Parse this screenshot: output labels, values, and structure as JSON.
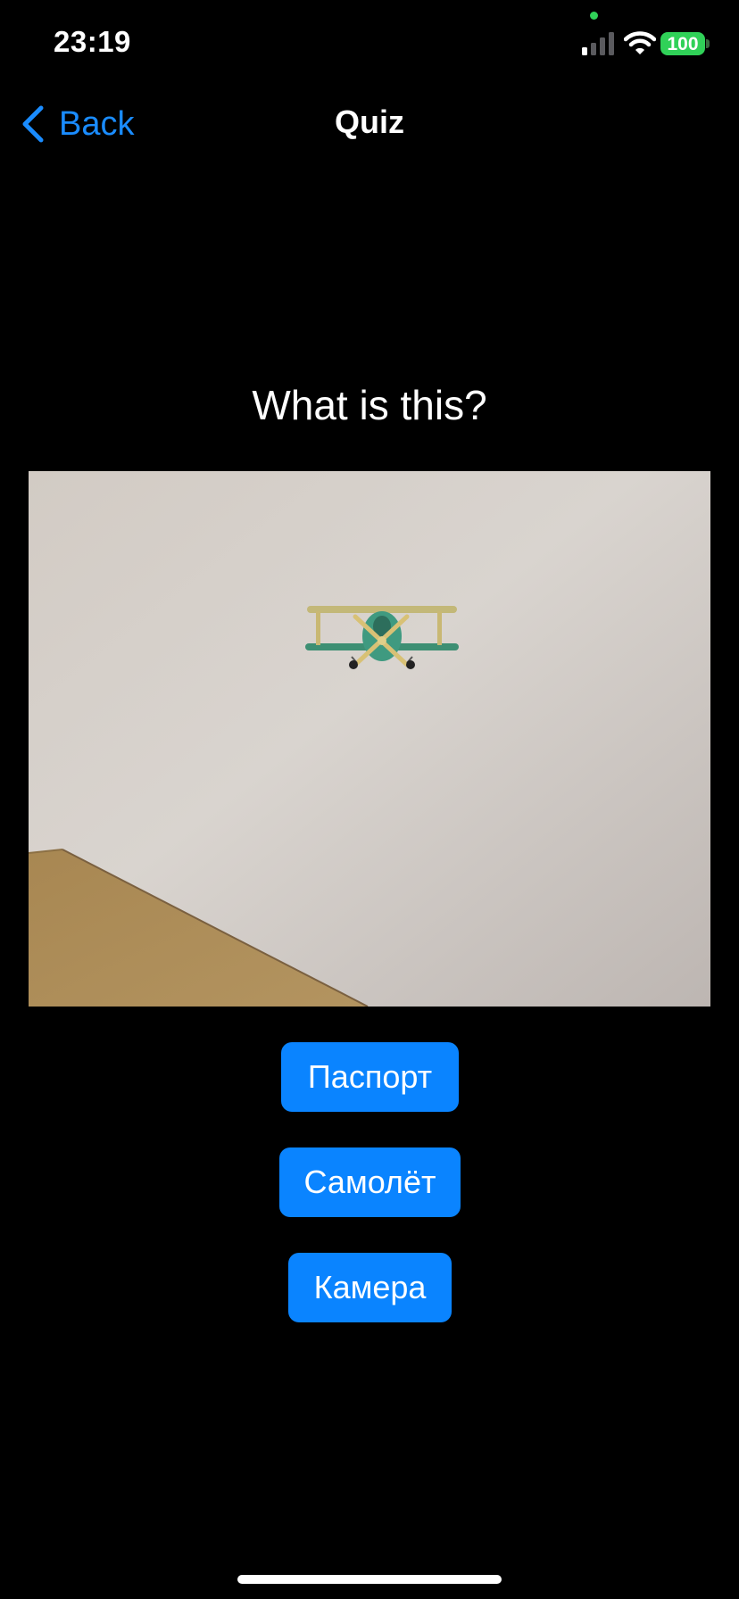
{
  "status_bar": {
    "time": "23:19",
    "battery": "100",
    "icons": [
      "signal-icon",
      "wifi-icon",
      "battery-icon"
    ]
  },
  "nav": {
    "back_label": "Back",
    "title": "Quiz"
  },
  "quiz": {
    "question": "What is this?",
    "answers": [
      "Паспорт",
      "Самолёт",
      "Камера"
    ]
  },
  "colors": {
    "accent": "#0a84ff",
    "back_text": "#1a8cff",
    "background": "#000000",
    "battery": "#30d158"
  }
}
